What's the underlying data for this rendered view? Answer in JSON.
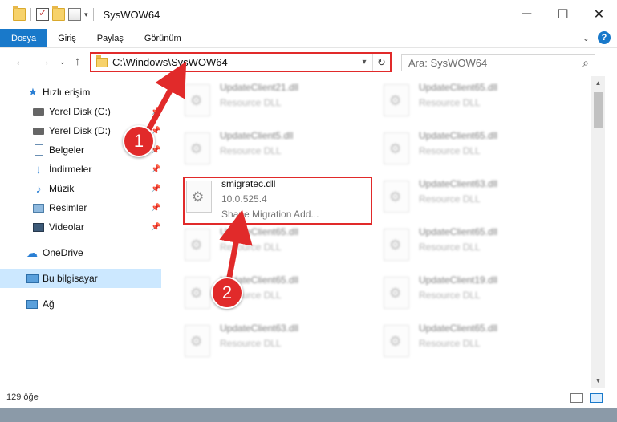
{
  "window": {
    "title": "SysWOW64",
    "minimize_glyph": "─",
    "maximize_glyph": "☐",
    "close_glyph": "✕"
  },
  "ribbon": {
    "tabs": [
      "Dosya",
      "Giriş",
      "Paylaş",
      "Görünüm"
    ],
    "accent_color": "#1979ca"
  },
  "address": {
    "path": "C:\\Windows\\SysWOW64",
    "search_placeholder": "Ara: SysWOW64"
  },
  "sidebar": {
    "items": [
      {
        "label": "Hızlı erişim",
        "icon": "star-icon"
      },
      {
        "label": "Yerel Disk (C:)",
        "icon": "drive-icon"
      },
      {
        "label": "Yerel Disk (D:)",
        "icon": "drive-icon"
      },
      {
        "label": "Belgeler",
        "icon": "documents-icon"
      },
      {
        "label": "İndirmeler",
        "icon": "download-icon"
      },
      {
        "label": "Müzik",
        "icon": "music-icon"
      },
      {
        "label": "Resimler",
        "icon": "pictures-icon"
      },
      {
        "label": "Videolar",
        "icon": "videos-icon"
      },
      {
        "label": "OneDrive",
        "icon": "cloud-icon"
      },
      {
        "label": "Bu bilgisayar",
        "icon": "computer-icon"
      },
      {
        "label": "Ağ",
        "icon": "network-icon"
      }
    ]
  },
  "files": [
    {
      "name": "UpdateClient21.dll",
      "type": "Resource DLL"
    },
    {
      "name": "UpdateClient65.dll",
      "type": "Resource DLL"
    },
    {
      "name": "UpdateClient5.dll",
      "type": "Resource DLL"
    },
    {
      "name": "UpdateClient65.dll",
      "type": "Resource DLL"
    },
    {
      "name": "smigratec.dll",
      "type": "10.0.525.4",
      "extra": "Shape Migration Add..."
    },
    {
      "name": "UpdateClient63.dll",
      "type": "Resource DLL"
    },
    {
      "name": "UpdateClient65.dll",
      "type": "Resource DLL"
    },
    {
      "name": "UpdateClient65.dll",
      "type": "Resource DLL"
    },
    {
      "name": "UpdateClient65.dll",
      "type": "Resource DLL"
    },
    {
      "name": "UpdateClient19.dll",
      "type": "Resource DLL"
    },
    {
      "name": "UpdateClient63.dll",
      "type": "Resource DLL"
    },
    {
      "name": "UpdateClient65.dll",
      "type": "Resource DLL"
    }
  ],
  "status": {
    "item_count": "129 öğe"
  },
  "annotations": {
    "badge1": "1",
    "badge2": "2",
    "color": "#e12a2a"
  }
}
